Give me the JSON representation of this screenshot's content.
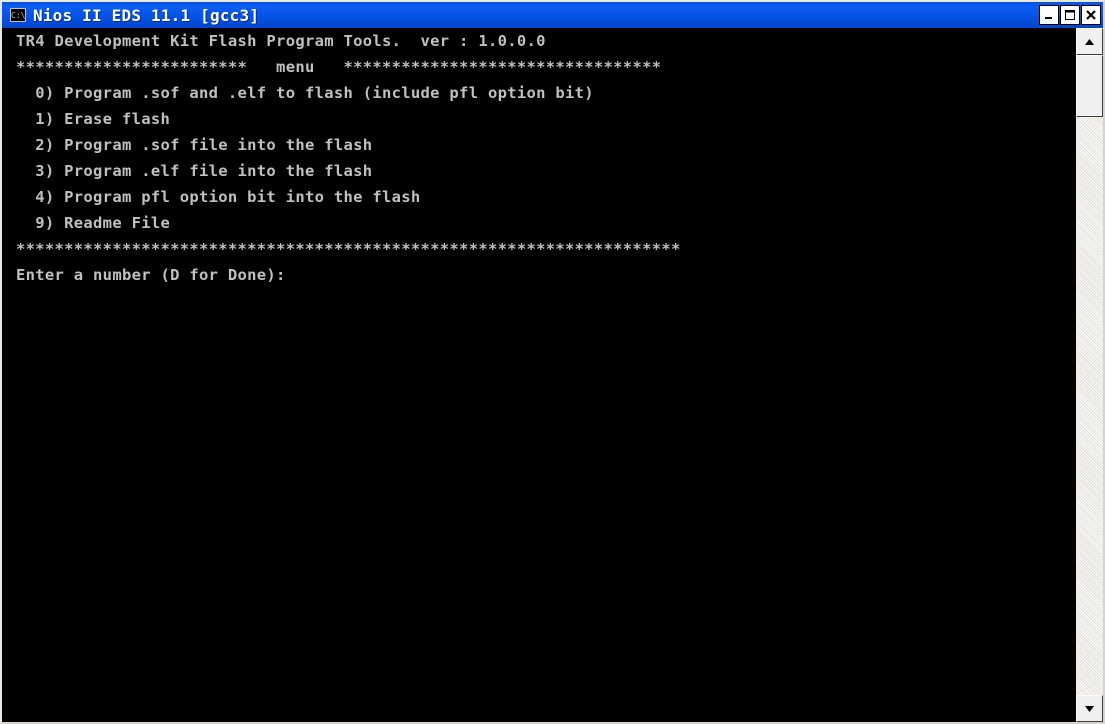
{
  "window": {
    "title": "Nios II EDS 11.1 [gcc3]",
    "icon_text": "C:\\",
    "buttons": {
      "minimize": "minimize-icon",
      "maximize": "maximize-icon",
      "close": "close-icon"
    }
  },
  "console": {
    "lines": [
      "TR4 Development Kit Flash Program Tools.  ver : 1.0.0.0",
      "************************   menu   *********************************",
      "  0) Program .sof and .elf to flash (include pfl option bit)",
      "  1) Erase flash",
      "  2) Program .sof file into the flash",
      "  3) Program .elf file into the flash",
      "  4) Program pfl option bit into the flash",
      "  9) Readme File",
      "*********************************************************************",
      "Enter a number (D for Done):"
    ]
  },
  "colors": {
    "titlebar": "#0551e0",
    "console_bg": "#000000",
    "console_fg": "#c0c0c0"
  }
}
